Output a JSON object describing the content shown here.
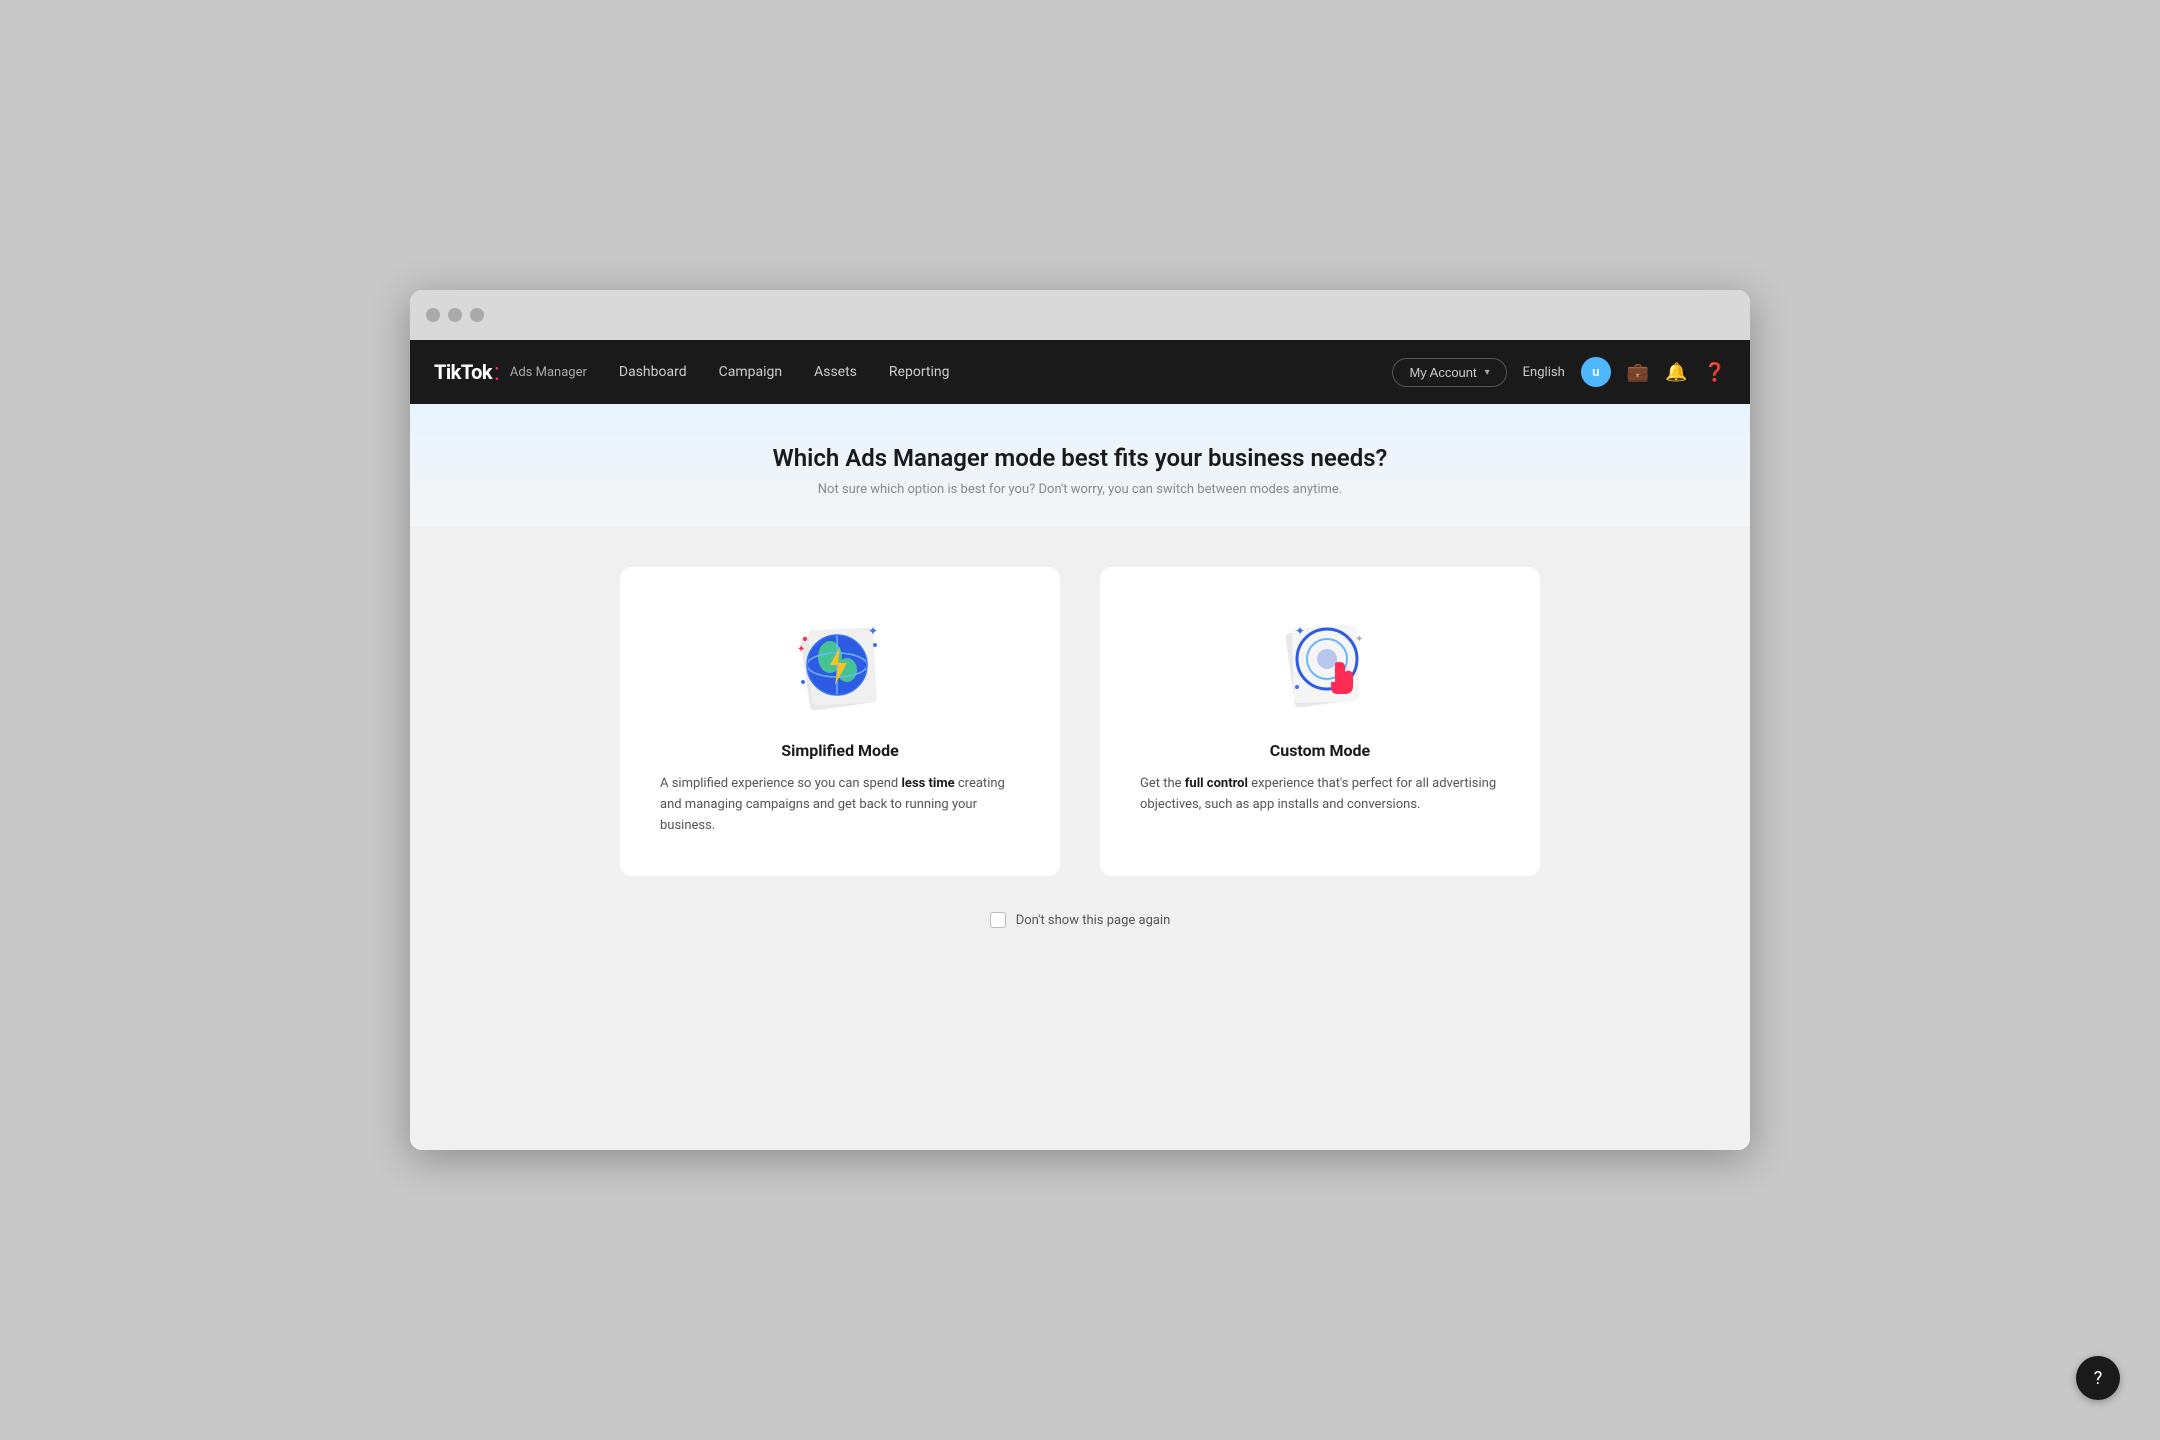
{
  "browser": {
    "dots": [
      "dot1",
      "dot2",
      "dot3"
    ]
  },
  "navbar": {
    "brand": {
      "tiktok": "TikTok",
      "dot": ":",
      "ads_manager": "Ads Manager"
    },
    "nav_items": [
      {
        "label": "Dashboard",
        "id": "dashboard"
      },
      {
        "label": "Campaign",
        "id": "campaign"
      },
      {
        "label": "Assets",
        "id": "assets"
      },
      {
        "label": "Reporting",
        "id": "reporting"
      }
    ],
    "my_account_label": "My Account",
    "language": "English",
    "avatar_letter": "u"
  },
  "hero": {
    "title": "Which Ads Manager mode best fits your business needs?",
    "subtitle": "Not sure which option is best for you? Don't worry, you can switch between modes anytime."
  },
  "simplified_mode": {
    "title": "Simplified Mode",
    "description_prefix": "A simplified experience so you can spend ",
    "description_highlight": "less time",
    "description_suffix": " creating and managing campaigns and get back to running your business."
  },
  "custom_mode": {
    "title": "Custom Mode",
    "description_prefix": "Get the ",
    "description_highlight": "full control",
    "description_suffix": " experience that's perfect for all advertising objectives, such as app installs and conversions."
  },
  "checkbox": {
    "label": "Don't show this page again"
  },
  "floating_help": {
    "icon": "?"
  }
}
